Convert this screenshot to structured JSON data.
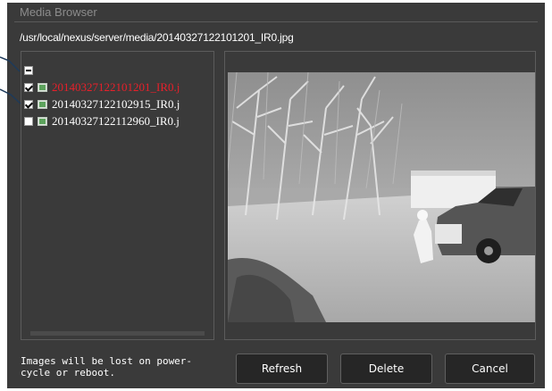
{
  "window": {
    "title": "Media Browser"
  },
  "path": "/usr/local/nexus/server/media/20140327122101201_IR0.jpg",
  "file_tree": {
    "root_state": "partial",
    "files": [
      {
        "name": "20140327122101201_IR0.j",
        "checked": true,
        "selected": true
      },
      {
        "name": "20140327122102915_IR0.j",
        "checked": true,
        "selected": false
      },
      {
        "name": "20140327122112960_IR0.j",
        "checked": false,
        "selected": false
      }
    ]
  },
  "notice": "Images will be lost on power-cycle or reboot.",
  "buttons": {
    "refresh": "Refresh",
    "delete": "Delete",
    "cancel": "Cancel"
  },
  "colors": {
    "dialog_bg": "#3a3a3a",
    "selected_text": "#e8202a",
    "button_bg": "#262626"
  },
  "icons": {
    "file": "image-file-icon"
  }
}
